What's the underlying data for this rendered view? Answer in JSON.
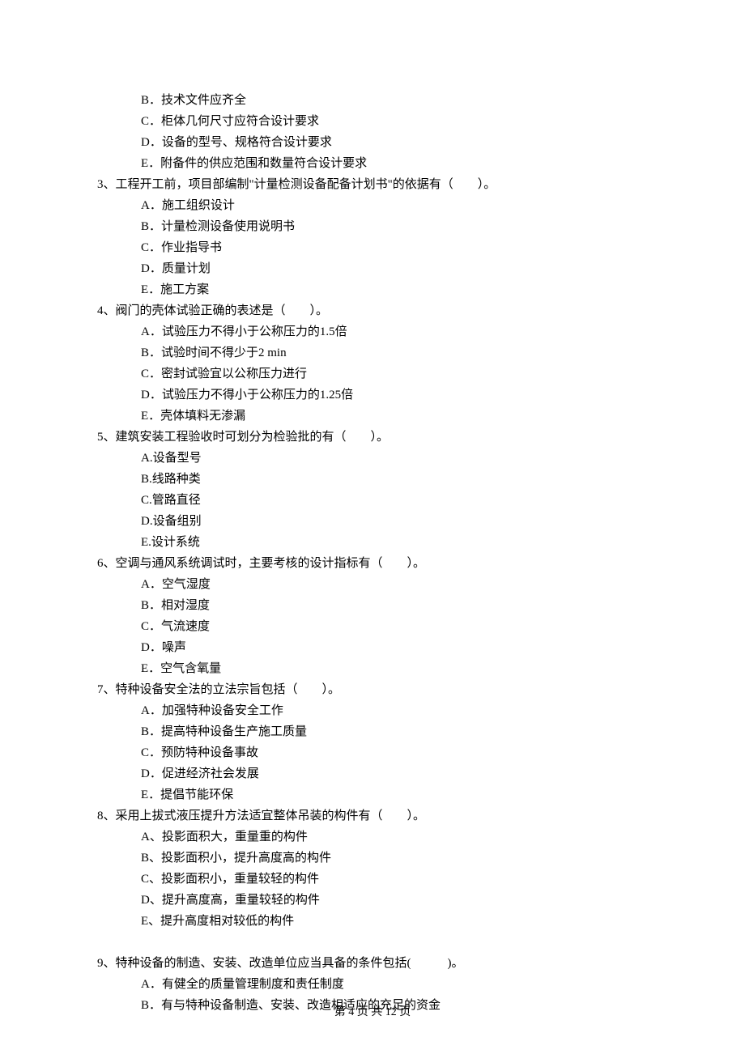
{
  "prev_q_options": {
    "B": "B．技术文件应齐全",
    "C": "C．柜体几何尺寸应符合设计要求",
    "D": "D．设备的型号、规格符合设计要求",
    "E": "E．附备件的供应范围和数量符合设计要求"
  },
  "q3": {
    "stem": "3、工程开工前，项目部编制\"计量检测设备配备计划书\"的依据有（　　）。",
    "A": "A．施工组织设计",
    "B": "B．计量检测设备使用说明书",
    "C": "C．作业指导书",
    "D": "D．质量计划",
    "E": "E．施工方案"
  },
  "q4": {
    "stem": "4、阀门的壳体试验正确的表述是（　　）。",
    "A": "A．试验压力不得小于公称压力的1.5倍",
    "B": "B．试验时间不得少于2 min",
    "C": "C．密封试验宜以公称压力进行",
    "D": "D．试验压力不得小于公称压力的1.25倍",
    "E": "E．壳体填料无渗漏"
  },
  "q5": {
    "stem": "5、建筑安装工程验收时可划分为检验批的有（　　）。",
    "A": "A.设备型号",
    "B": "B.线路种类",
    "C": "C.管路直径",
    "D": "D.设备组别",
    "E": "E.设计系统"
  },
  "q6": {
    "stem": "6、空调与通风系统调试时，主要考核的设计指标有（　　）。",
    "A": "A．空气湿度",
    "B": "B．相对湿度",
    "C": "C．气流速度",
    "D": "D．噪声",
    "E": "E．空气含氧量"
  },
  "q7": {
    "stem": "7、特种设备安全法的立法宗旨包括（　　）。",
    "A": "A．加强特种设备安全工作",
    "B": "B．提高特种设备生产施工质量",
    "C": "C．预防特种设备事故",
    "D": "D．促进经济社会发展",
    "E": "E．提倡节能环保"
  },
  "q8": {
    "stem": "8、采用上拔式液压提升方法适宜整体吊装的构件有（　　）。",
    "A": "A、投影面积大，重量重的构件",
    "B": "B、投影面积小，提升高度高的构件",
    "C": "C、投影面积小，重量较轻的构件",
    "D": "D、提升高度高，重量较轻的构件",
    "E": "E、提升高度相对较低的构件"
  },
  "q9": {
    "stem": "9、特种设备的制造、安装、改造单位应当具备的条件包括(　　　)。",
    "A": "A．有健全的质量管理制度和责任制度",
    "B": "B．有与特种设备制造、安装、改造相适应的充足的资金"
  },
  "footer": "第 4 页 共 12 页"
}
